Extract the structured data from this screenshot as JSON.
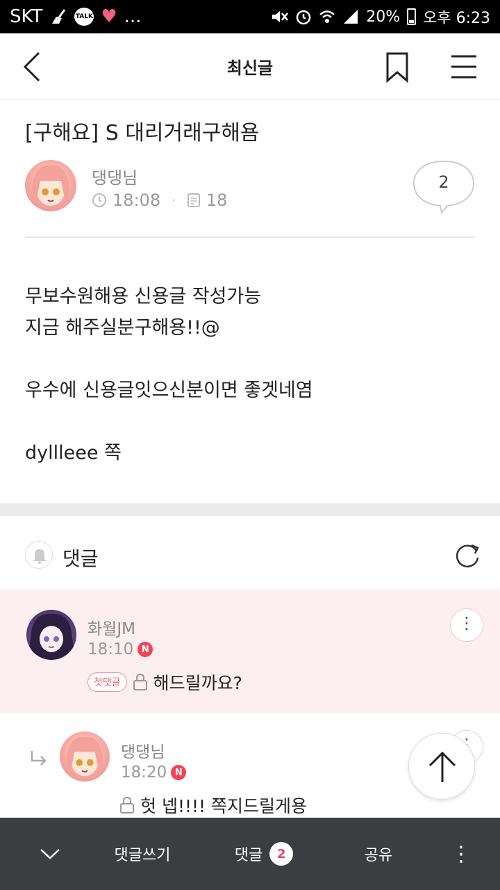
{
  "status_bar": {
    "carrier": "SKT",
    "talk_badge": "TALK",
    "extra_indicator": "...",
    "battery_percent": "20%",
    "time": "오후 6:23"
  },
  "header": {
    "title": "최신글"
  },
  "post": {
    "title": "[구해요] S 대리거래구해욤",
    "author": "댕댕님",
    "time": "18:08",
    "views": "18",
    "comment_count": "2",
    "body_lines": [
      "무보수원해용 신용글 작성가능",
      "지금 해주실분구해용!!@",
      "",
      "우수에 신용글잇으신분이면 좋겟네염",
      "",
      "dyllleee 쪽"
    ]
  },
  "comments_section": {
    "label": "댓글",
    "comments": [
      {
        "author": "화월JM",
        "time": "18:10",
        "new_badge": "N",
        "first_badge": "첫댓글",
        "text": "해드릴까요?"
      },
      {
        "author": "댕댕님",
        "time": "18:20",
        "new_badge": "N",
        "text": "헛 넵!!!! 쪽지드릴게용"
      }
    ]
  },
  "bottom_bar": {
    "write_label": "댓글쓰기",
    "comments_label": "댓글",
    "comments_count": "2",
    "share_label": "공유"
  },
  "colors": {
    "accent_red": "#f44156",
    "highlight_comment_bg": "#fdeef0",
    "bottom_bar_bg": "#3c3d40"
  }
}
